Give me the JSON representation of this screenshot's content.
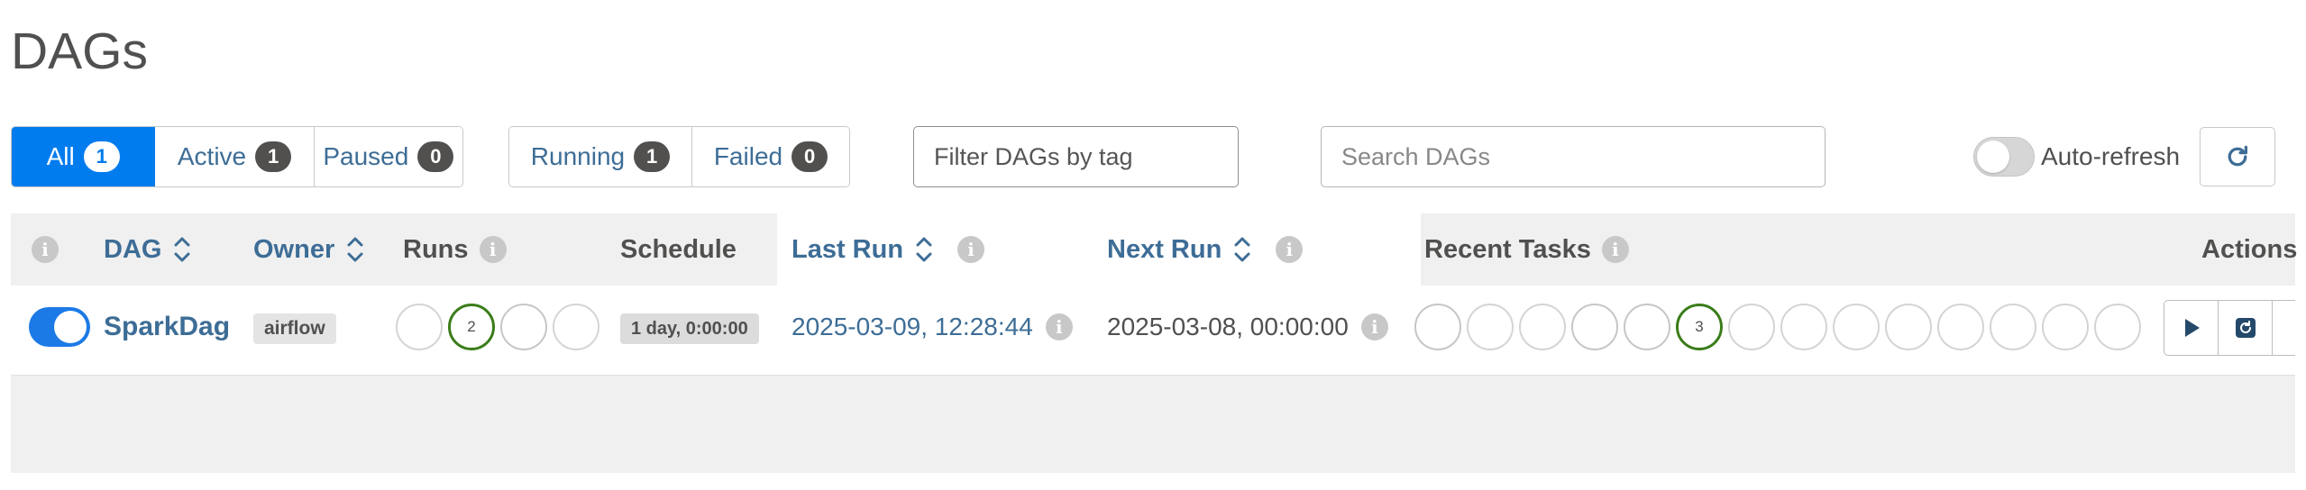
{
  "page": {
    "title": "DAGs"
  },
  "status_filters": [
    {
      "label": "All",
      "count": "1",
      "active": true
    },
    {
      "label": "Active",
      "count": "1",
      "active": false
    },
    {
      "label": "Paused",
      "count": "0",
      "active": false
    }
  ],
  "run_filters": [
    {
      "label": "Running",
      "count": "1"
    },
    {
      "label": "Failed",
      "count": "0"
    }
  ],
  "tag_filter": {
    "placeholder": "Filter DAGs by tag"
  },
  "search": {
    "placeholder": "Search DAGs"
  },
  "auto_refresh": {
    "label": "Auto-refresh",
    "enabled": false
  },
  "table": {
    "headers": {
      "dag": "DAG",
      "owner": "Owner",
      "runs": "Runs",
      "schedule": "Schedule",
      "last_run": "Last Run",
      "next_run": "Next Run",
      "recent_tasks": "Recent Tasks",
      "actions": "Actions"
    },
    "rows": [
      {
        "paused": false,
        "dag_id": "SparkDag",
        "owner": "airflow",
        "runs": [
          "",
          "2",
          "",
          ""
        ],
        "schedule": "1 day, 0:00:00",
        "last_run": "2025-03-09, 12:28:44",
        "next_run": "2025-03-08, 00:00:00",
        "recent_tasks": [
          "",
          "",
          "",
          "",
          "",
          "3",
          "",
          "",
          "",
          "",
          "",
          "",
          "",
          ""
        ]
      }
    ]
  },
  "colors": {
    "primary": "#017cee",
    "link": "#3d6d96",
    "success": "#3a7d1a",
    "header_bg": "#f0f0f0"
  },
  "icons": {
    "info": "info-icon",
    "sort": "sort-icon",
    "refresh": "refresh-icon",
    "trigger": "play-icon",
    "clear": "refresh-clear-icon"
  }
}
